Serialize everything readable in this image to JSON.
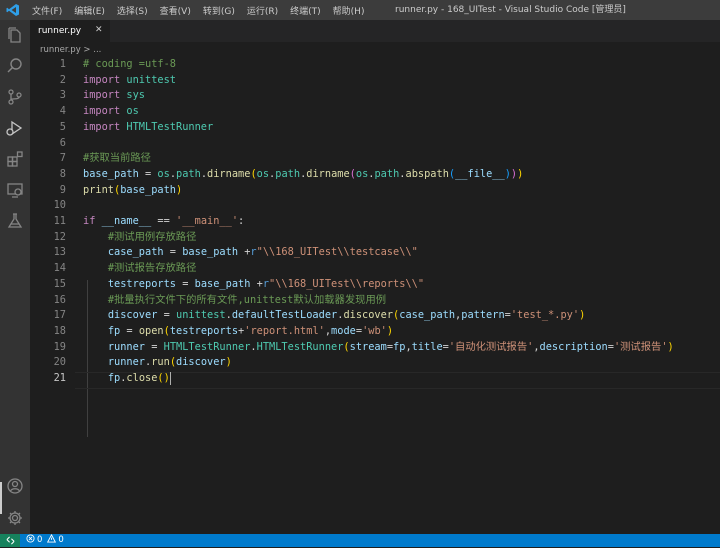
{
  "titlebar": {
    "menu": [
      "文件(F)",
      "编辑(E)",
      "选择(S)",
      "查看(V)",
      "转到(G)",
      "运行(R)",
      "终端(T)",
      "帮助(H)"
    ],
    "title": "runner.py - 168_UITest - Visual Studio Code [管理员]"
  },
  "tab": {
    "label": "runner.py",
    "close": "✕"
  },
  "breadcrumb": "runner.py > ...",
  "editor": {
    "line_numbers": [
      "1",
      "2",
      "3",
      "4",
      "5",
      "6",
      "7",
      "8",
      "9",
      "10",
      "11",
      "12",
      "13",
      "14",
      "15",
      "16",
      "17",
      "18",
      "19",
      "20",
      "21"
    ],
    "active_line": 21
  },
  "statusbar": {
    "errors": "0",
    "warnings": "0"
  },
  "colors": {
    "accent": "#007acc",
    "remote": "#16825d"
  },
  "icons": [
    "vscode-logo-icon",
    "explorer-icon",
    "search-icon",
    "source-control-icon",
    "run-debug-icon",
    "extensions-icon",
    "remote-explorer-icon",
    "testing-icon",
    "account-icon",
    "manage-gear-icon",
    "remote-indicator-icon",
    "error-icon",
    "warning-icon"
  ]
}
